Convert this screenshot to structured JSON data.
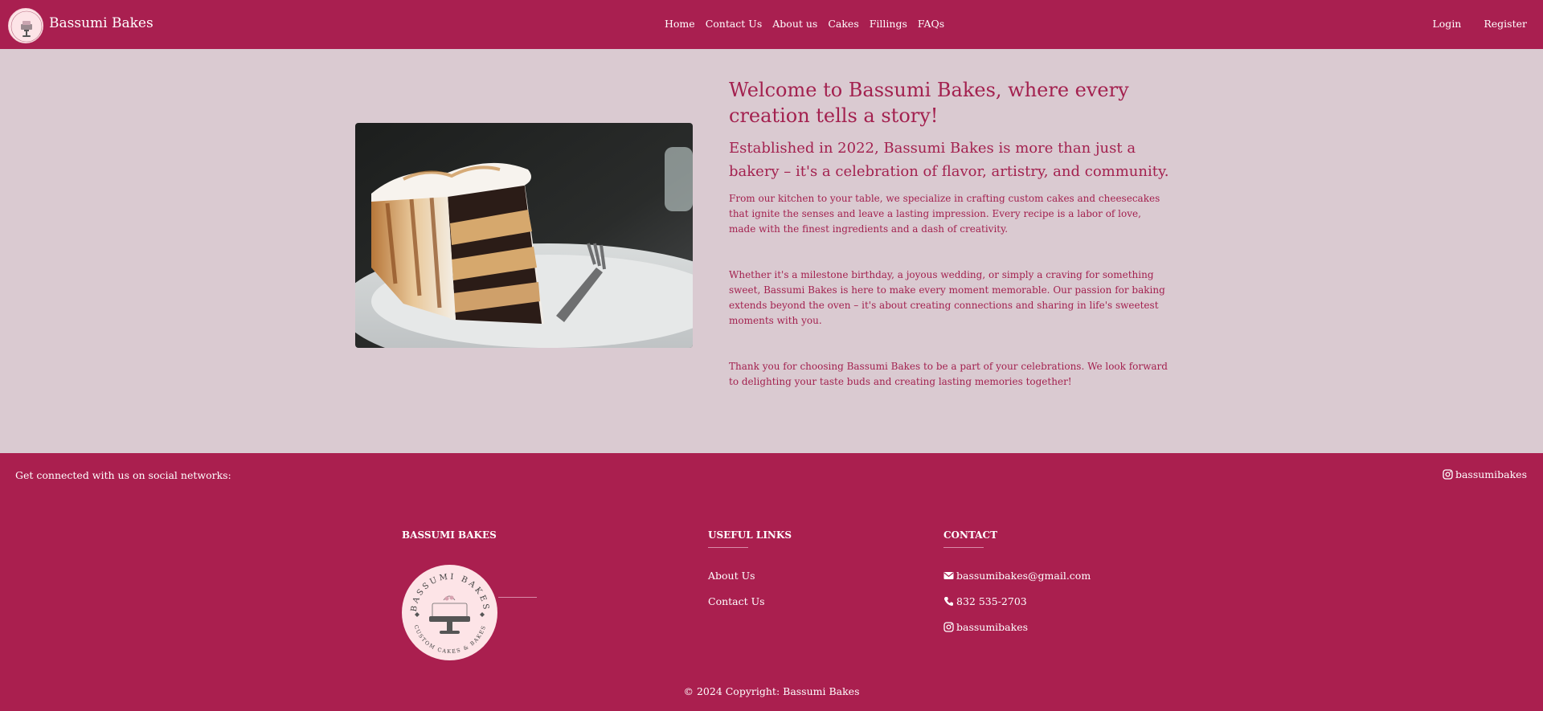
{
  "header": {
    "brand_name": "Bassumi Bakes",
    "nav_links": [
      "Home",
      "Contact Us",
      "About us",
      "Cakes",
      "Fillings",
      "FAQs"
    ],
    "login_label": "Login",
    "register_label": "Register"
  },
  "hero": {
    "title": "Welcome to Bassumi Bakes, where every creation tells a story!",
    "subtitle": "Established in 2022, Bassumi Bakes is more than just a bakery – it's a celebration of flavor, artistry, and community.",
    "paragraph1": "From our kitchen to your table, we specialize in crafting custom cakes and cheesecakes that ignite the senses and leave a lasting impression. Every recipe is a labor of love, made with the finest ingredients and a dash of creativity.",
    "paragraph2": "Whether it's a milestone birthday, a joyous wedding, or simply a craving for something sweet, Bassumi Bakes is here to make every moment memorable. Our passion for baking extends beyond the oven – it's about creating connections and sharing in life's sweetest moments with you.",
    "paragraph3": "Thank you for choosing Bassumi Bakes to be a part of your celebrations. We look forward to delighting your taste buds and creating lasting memories together!"
  },
  "footer": {
    "social_text": "Get connected with us on social networks:",
    "social_handle": "bassumibakes",
    "brand_heading": "BASSUMI BAKES",
    "logo_text_top": "BASSUMI BAKES",
    "logo_text_bottom": "CUSTOM CAKES & BAKES",
    "links_heading": "USEFUL LINKS",
    "links": [
      "About Us",
      "Contact Us"
    ],
    "contact_heading": "CONTACT",
    "email": "bassumibakes@gmail.com",
    "phone": "832 535-2703",
    "instagram": "bassumibakes",
    "copyright": "© 2024 Copyright: Bassumi Bakes"
  },
  "colors": {
    "brand": "#a91f50",
    "page_background": "#dacad1",
    "hero_text": "#a3214f",
    "logo_background": "#fde4e7"
  },
  "icons": {
    "social": "instagram-icon",
    "email": "envelope-icon",
    "phone": "phone-icon",
    "instagram": "instagram-icon"
  }
}
